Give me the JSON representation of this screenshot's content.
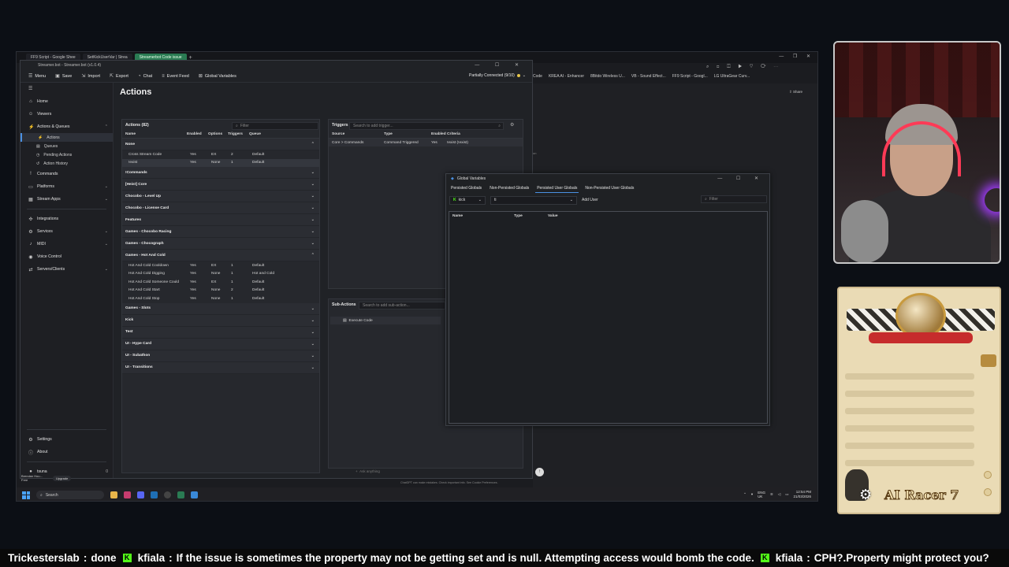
{
  "browser": {
    "tabs": [
      "FF9 Script - Google Shee",
      "SetKickUserVar | Strea",
      "Streamerbot Code issue"
    ],
    "bookmarks": [
      "Code",
      "KREA AI - Enhancer",
      "8Bitdo Wireless U...",
      "VB - Sound Effect...",
      "FF9 Script - Googl...",
      "LG UltraGear Curv..."
    ],
    "right_label": "on"
  },
  "streamerbot": {
    "title": "Streamer.bot - Streamer.bot (v1.0.4)",
    "menu": [
      "Menu",
      "Save",
      "Import",
      "Export",
      "Chat",
      "Event Feed",
      "Global Variables"
    ],
    "status": "Partially Connected (9/10)",
    "sidebar": {
      "items": [
        {
          "label": "Home",
          "icon": "home-icon"
        },
        {
          "label": "Viewers",
          "icon": "viewers-icon"
        },
        {
          "label": "Actions & Queues",
          "icon": "actions-icon"
        },
        {
          "label": "Commands",
          "icon": "commands-icon"
        },
        {
          "label": "Platforms",
          "icon": "platforms-icon"
        },
        {
          "label": "Stream Apps",
          "icon": "stream-apps-icon"
        },
        {
          "label": "Integrations",
          "icon": "integrations-icon"
        },
        {
          "label": "Services",
          "icon": "services-icon"
        },
        {
          "label": "MIDI",
          "icon": "midi-icon"
        },
        {
          "label": "Voice Control",
          "icon": "voice-icon"
        },
        {
          "label": "Servers/Clients",
          "icon": "servers-icon"
        }
      ],
      "sub_items": [
        "Actions",
        "Queues",
        "Pending Actions",
        "Action History"
      ],
      "bottom": [
        "Settings",
        "About"
      ],
      "user": "tsuna",
      "user_count": "0"
    },
    "page_title": "Actions",
    "actions": {
      "header": "Actions (82)",
      "filter_placeholder": "Filter",
      "columns": [
        "Name",
        "Enabled",
        "Options",
        "Triggers",
        "Queue"
      ],
      "group_none": "None",
      "rows_none": [
        [
          "Cross Stream Code",
          "Yes",
          "EX",
          "2",
          "Default"
        ],
        [
          "!exist",
          "Yes",
          "None",
          "1",
          "Default"
        ]
      ],
      "groups_a": [
        "!Commands",
        "[Heist] Core",
        "Chocobo - Level Up",
        "Chocobo - License Card",
        "Features",
        "Games - Chocobo Racing",
        "Games - Chocograph",
        "Games - Hot And Cold"
      ],
      "rows_hotcold": [
        [
          "Hot And Cold Cooldown",
          "Yes",
          "EX",
          "1",
          "Default"
        ],
        [
          "Hot And Cold Digging",
          "Yes",
          "None",
          "1",
          "Hot and Cold"
        ],
        [
          "Hot And Cold Someone Could",
          "Yes",
          "EX",
          "1",
          "Default"
        ],
        [
          "Hot And Cold Start",
          "Yes",
          "None",
          "2",
          "Default"
        ],
        [
          "Hot And Cold Stop",
          "Yes",
          "None",
          "1",
          "Default"
        ]
      ],
      "groups_b": [
        "Games - Slots",
        "Kick",
        "Test",
        "UI - Hype Card",
        "UI - Subathon",
        "UI - Transitions"
      ]
    },
    "triggers": {
      "header": "Triggers",
      "search_placeholder": "Search to add trigger...",
      "columns": [
        "Source",
        "Type",
        "Enabled",
        "Criteria"
      ],
      "row": [
        "Core > Commands",
        "Command Triggered",
        "Yes",
        "!exist (!exist)"
      ]
    },
    "subactions": {
      "header": "Sub-Actions",
      "search_placeholder": "Search to add sub-action...",
      "item": "Execute Code"
    },
    "chat_placeholder": "Ask anything",
    "chat_disclaimer": "ChatGPT can make mistakes. Check important info. See Cookie Preferences."
  },
  "global_variables": {
    "title": "Global Variables",
    "tabs": [
      "Persisted Globals",
      "Non-Persisted Globals",
      "Persisted User Globals",
      "Non-Persisted User Globals"
    ],
    "platform": "kick",
    "user_select": "ti",
    "add_user": "Add User",
    "filter_placeholder": "Filter",
    "columns": [
      "Name",
      "Type",
      "Value"
    ]
  },
  "taskbar": {
    "search": "Search",
    "lang": "ENG\nUK",
    "time": "12:54 PM",
    "date": "21/03/2026"
  },
  "bottom_user": {
    "name": "Brendan Hou...",
    "plan": "Free",
    "upgrade": "Upgrade"
  },
  "overlay": {
    "game_title": "AI Racer 7"
  },
  "ticker": [
    {
      "user": "Trickesterslab",
      "msg": "done"
    },
    {
      "user": "kfiala",
      "msg": "If the issue is sometimes the property may not be getting set and is null. Attempting access would bomb the code."
    },
    {
      "user": "kfiala",
      "msg": "CPH?.Property might protect you?"
    }
  ],
  "colors": {
    "accent": "#4a90e2",
    "status_dot": "#e8c74a",
    "kick_green": "#53fc18",
    "browser_active_tab": "#2a7b53"
  }
}
